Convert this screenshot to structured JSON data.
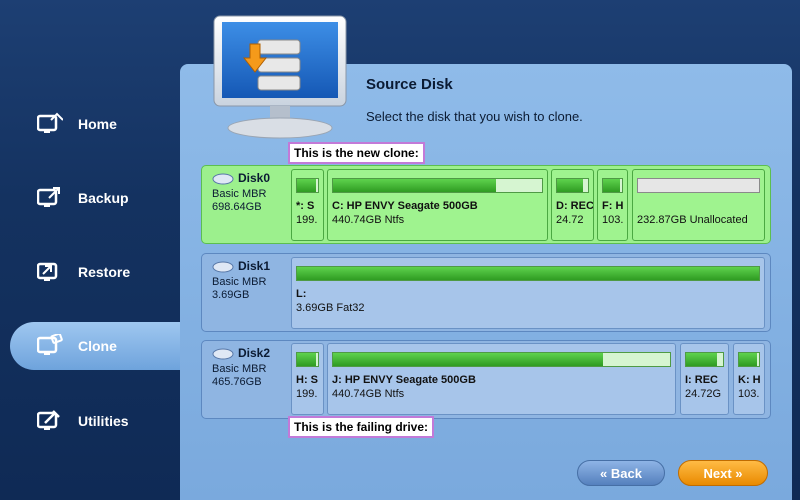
{
  "nav": {
    "items": [
      {
        "label": "Home",
        "icon": "home-icon"
      },
      {
        "label": "Backup",
        "icon": "backup-icon"
      },
      {
        "label": "Restore",
        "icon": "restore-icon"
      },
      {
        "label": "Clone",
        "icon": "clone-icon",
        "active": true
      },
      {
        "label": "Utilities",
        "icon": "utilities-icon"
      }
    ]
  },
  "header": {
    "title": "Source Disk",
    "subtitle": "Select the disk that you wish to clone."
  },
  "callouts": {
    "new_clone": "This is the new clone:",
    "failing": "This is the failing drive:"
  },
  "disks": [
    {
      "name": "Disk0",
      "type": "Basic MBR",
      "size": "698.64GB",
      "partitions": [
        {
          "label": "*: S",
          "size": "199.",
          "fill": 0.9
        },
        {
          "label": "C: HP ENVY Seagate 500GB",
          "size": "440.74GB Ntfs",
          "fill": 0.78
        },
        {
          "label": "D: REC",
          "size": "24.72",
          "fill": 0.85
        },
        {
          "label": "F: H",
          "size": "103.",
          "fill": 0.9
        },
        {
          "label": "",
          "size": "232.87GB Unallocated",
          "fill": 0
        }
      ]
    },
    {
      "name": "Disk1",
      "type": "Basic MBR",
      "size": "3.69GB",
      "partitions": [
        {
          "label": "L:",
          "size": "3.69GB Fat32",
          "fill": 1.0
        }
      ]
    },
    {
      "name": "Disk2",
      "type": "Basic MBR",
      "size": "465.76GB",
      "partitions": [
        {
          "label": "H: S",
          "size": "199.",
          "fill": 0.9
        },
        {
          "label": "J: HP ENVY Seagate 500GB",
          "size": "440.74GB Ntfs",
          "fill": 0.8
        },
        {
          "label": "I: REC",
          "size": "24.72G",
          "fill": 0.85
        },
        {
          "label": "K: H",
          "size": "103.",
          "fill": 0.9
        }
      ]
    }
  ],
  "buttons": {
    "back": "« Back",
    "next": "Next »"
  },
  "colors": {
    "selected_disk": "#9cf08d",
    "next_button": "#f19a12",
    "back_button": "#6f97cf"
  }
}
